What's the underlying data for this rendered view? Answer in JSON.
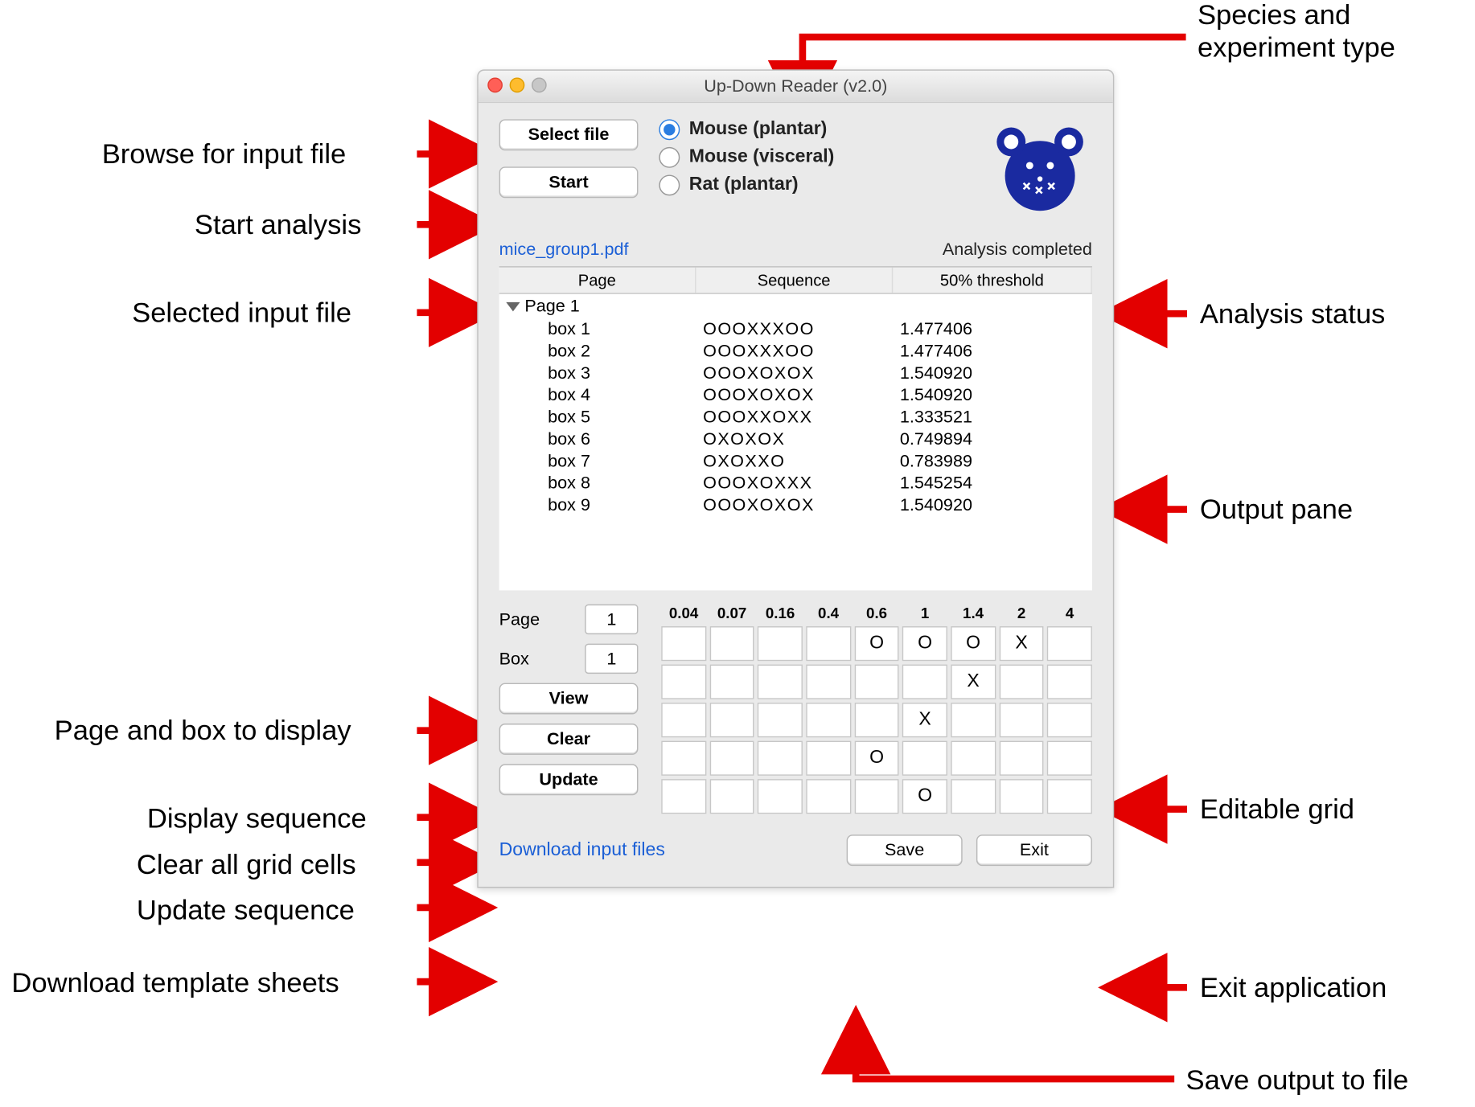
{
  "window": {
    "title": "Up-Down Reader (v2.0)",
    "buttons": {
      "select_file": "Select file",
      "start": "Start"
    },
    "species": {
      "options": [
        "Mouse (plantar)",
        "Mouse (visceral)",
        "Rat (plantar)"
      ],
      "selected_index": 0
    },
    "filename": "mice_group1.pdf",
    "status": "Analysis completed",
    "tree": {
      "headers": [
        "Page",
        "Sequence",
        "50% threshold"
      ],
      "group_label": "Page 1",
      "rows": [
        {
          "box": "box 1",
          "seq": "OOOXXXOO",
          "thr": "1.477406"
        },
        {
          "box": "box 2",
          "seq": "OOOXXXOO",
          "thr": "1.477406"
        },
        {
          "box": "box 3",
          "seq": "OOOXOXOX",
          "thr": "1.540920"
        },
        {
          "box": "box 4",
          "seq": "OOOXOXOX",
          "thr": "1.540920"
        },
        {
          "box": "box 5",
          "seq": "OOOXXOXX",
          "thr": "1.333521"
        },
        {
          "box": "box 6",
          "seq": "OXOXOX",
          "thr": "0.749894"
        },
        {
          "box": "box 7",
          "seq": "OXOXXO",
          "thr": "0.783989"
        },
        {
          "box": "box 8",
          "seq": "OOOXOXXX",
          "thr": "1.545254"
        },
        {
          "box": "box 9",
          "seq": "OOOXOXOX",
          "thr": "1.540920"
        }
      ]
    },
    "pagebox": {
      "page_label": "Page",
      "page_value": "1",
      "box_label": "Box",
      "box_value": "1",
      "view": "View",
      "clear": "Clear",
      "update": "Update"
    },
    "grid": {
      "headers": [
        "0.04",
        "0.07",
        "0.16",
        "0.4",
        "0.6",
        "1",
        "1.4",
        "2",
        "4"
      ],
      "cells": [
        [
          "",
          "",
          "",
          "",
          "O",
          "O",
          "O",
          "X",
          ""
        ],
        [
          "",
          "",
          "",
          "",
          "",
          "",
          "X",
          "",
          ""
        ],
        [
          "",
          "",
          "",
          "",
          "",
          "X",
          "",
          "",
          ""
        ],
        [
          "",
          "",
          "",
          "",
          "O",
          "",
          "",
          "",
          ""
        ],
        [
          "",
          "",
          "",
          "",
          "",
          "O",
          "",
          "",
          ""
        ]
      ]
    },
    "download_link": "Download input files",
    "save": "Save",
    "exit": "Exit"
  },
  "labels": {
    "browse": "Browse for input file",
    "start": "Start analysis",
    "selected_file": "Selected input file",
    "pagebox": "Page and box to display",
    "display_seq": "Display sequence",
    "clear_grid": "Clear all grid cells",
    "update_seq": "Update sequence",
    "download": "Download template sheets",
    "species": "Species and\nexperiment type",
    "analysis_status": "Analysis status",
    "output_pane": "Output pane",
    "editable_grid": "Editable grid",
    "exit": "Exit application",
    "save": "Save output to file"
  }
}
